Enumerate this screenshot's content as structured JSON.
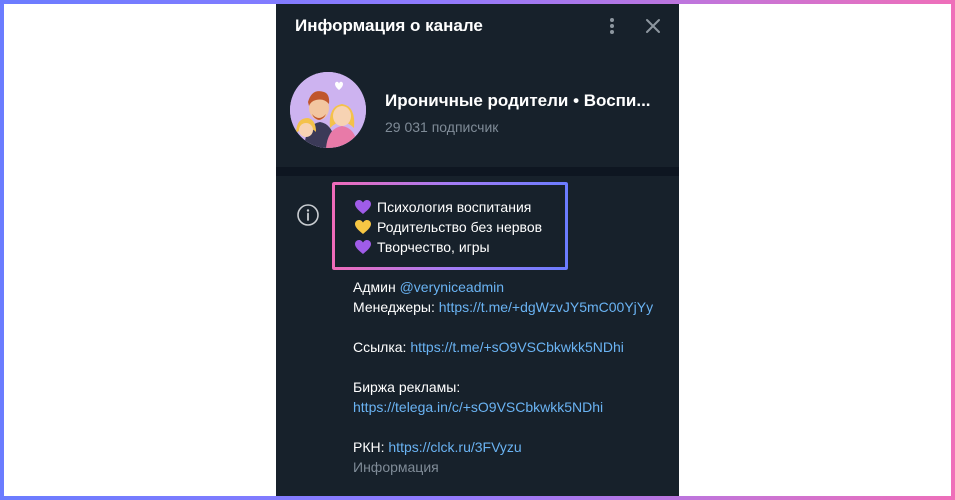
{
  "header": {
    "title": "Информация о канале",
    "menu_icon": "kebab-menu-icon",
    "close_icon": "close-icon"
  },
  "channel": {
    "name": "Ироничные родители • Воспи...",
    "subscribers": "29 031 подписчик"
  },
  "description": {
    "lines": [
      {
        "icon": "purple-heart-icon",
        "text": "Психология воспитания"
      },
      {
        "icon": "yellow-heart-icon",
        "text": "Родительство без нервов"
      },
      {
        "icon": "purple-heart-icon",
        "text": "Творчество, игры"
      }
    ]
  },
  "details": {
    "admin_label": "Админ",
    "admin_handle": "@veryniceadmin",
    "managers_label": "Менеджеры:",
    "managers_link": "https://t.me/+dgWzvJY5mC00YjYy",
    "link_label": "Ссылка:",
    "link_url": "https://t.me/+sO9VSCbkwkk5NDhi",
    "ads_label": "Биржа рекламы:",
    "ads_url": "https://telega.in/c/+sO9VSCbkwkk5NDhi",
    "rkn_label": "РКН:",
    "rkn_url": "https://clck.ru/3FVyzu",
    "caption": "Информация"
  },
  "colors": {
    "panel_bg": "#17212b",
    "link": "#6ab3f3",
    "muted": "#7f8b97",
    "purple_heart": "#a05ce8",
    "yellow_heart": "#f7c744"
  }
}
